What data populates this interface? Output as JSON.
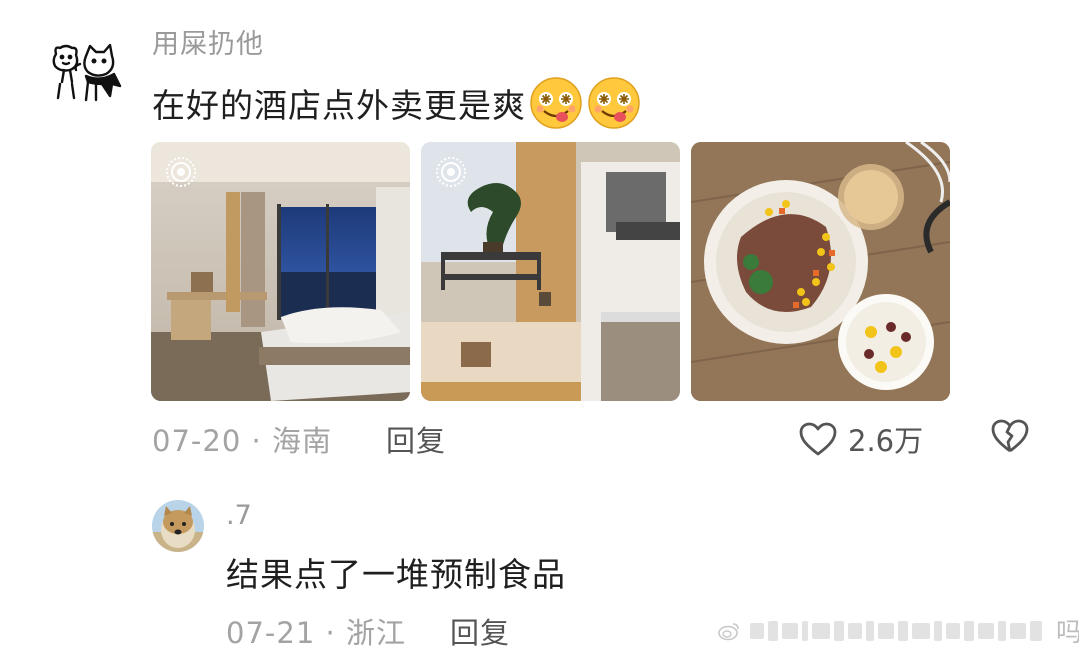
{
  "comment": {
    "username": "用屎扔他",
    "text": "在好的酒店点外卖更是爽",
    "emoji_count": 2,
    "date": "07-20",
    "location": "海南",
    "reply_label": "回复",
    "like_count": "2.6万",
    "images": [
      "hotel-room-photo",
      "hotel-bonsai-kitchen-photo",
      "takeout-food-photo"
    ]
  },
  "reply": {
    "username": ".7",
    "text": "结果点了一堆预制食品",
    "date": "07-21",
    "location": "浙江",
    "reply_label": "回复"
  },
  "watermark": {
    "text": "吗"
  },
  "colors": {
    "meta_gray": "#a3a3a3",
    "text_dark": "#1f1f1f",
    "icon_gray": "#555555"
  }
}
